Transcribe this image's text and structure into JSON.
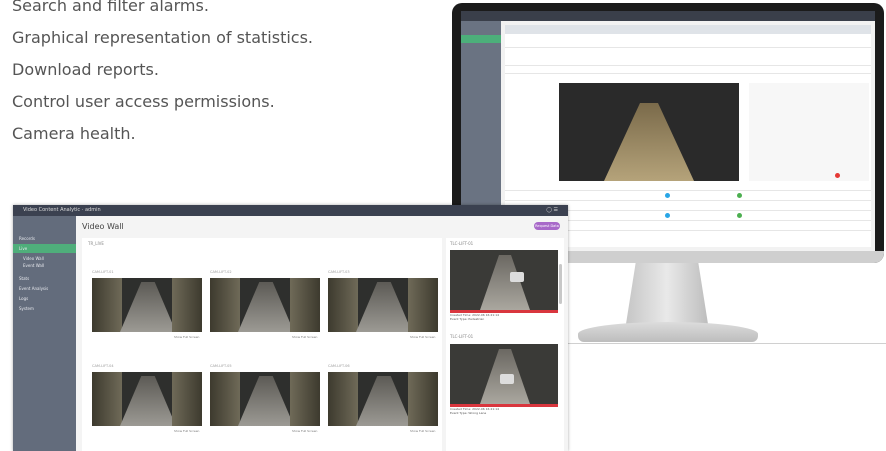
{
  "features": [
    "Search and filter alarms.",
    "Graphical representation of statistics.",
    "Download reports.",
    "Control user access permissions.",
    "Camera health."
  ],
  "app": {
    "title": "Video Content Analytic",
    "user": "admin",
    "sidebar": [
      "Records",
      "Live",
      "Video Wall",
      "Event Wall",
      "Stats",
      "Event Analysis",
      "Logs",
      "System"
    ],
    "page_title": "Video Wall",
    "action_button": "Request Data",
    "panel_label": "TR_LIVE",
    "cameras": [
      {
        "label": "CAM-LIFT-01",
        "link": "Show Full Screen"
      },
      {
        "label": "CAM-LIFT-02",
        "link": "Show Full Screen"
      },
      {
        "label": "CAM-LIFT-03",
        "link": "Show Full Screen"
      },
      {
        "label": "CAM-LIFT-04",
        "link": "Show Full Screen"
      },
      {
        "label": "CAM-LIFT-05",
        "link": "Show Full Screen"
      },
      {
        "label": "CAM-LIFT-06",
        "link": "Show Full Screen"
      }
    ],
    "alarms": [
      {
        "title": "TLC-LIFT-01",
        "time": "Created Time: 2022-06 16:21:14",
        "type": "Event Type: Pedestrian"
      },
      {
        "title": "TLC-LIFT-01",
        "time": "Created Time: 2022-06 16:21:14",
        "type": "Event Type: Wrong Lane"
      }
    ]
  }
}
